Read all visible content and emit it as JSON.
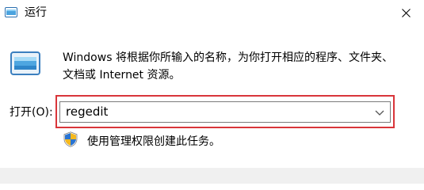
{
  "window": {
    "title": "运行",
    "icon": "run-icon",
    "close_icon": "close-icon"
  },
  "description": "Windows 将根据你所输入的名称，为你打开相应的程序、文件夹、文档或 Internet 资源。",
  "open": {
    "label": "打开(O):",
    "value": "regedit",
    "dropdown_icon": "chevron-down-icon"
  },
  "admin_note": {
    "icon": "uac-shield-icon",
    "text": "使用管理权限创建此任务。"
  },
  "colors": {
    "highlight": "#d9353a",
    "footer_bg": "#f0f0f0"
  }
}
